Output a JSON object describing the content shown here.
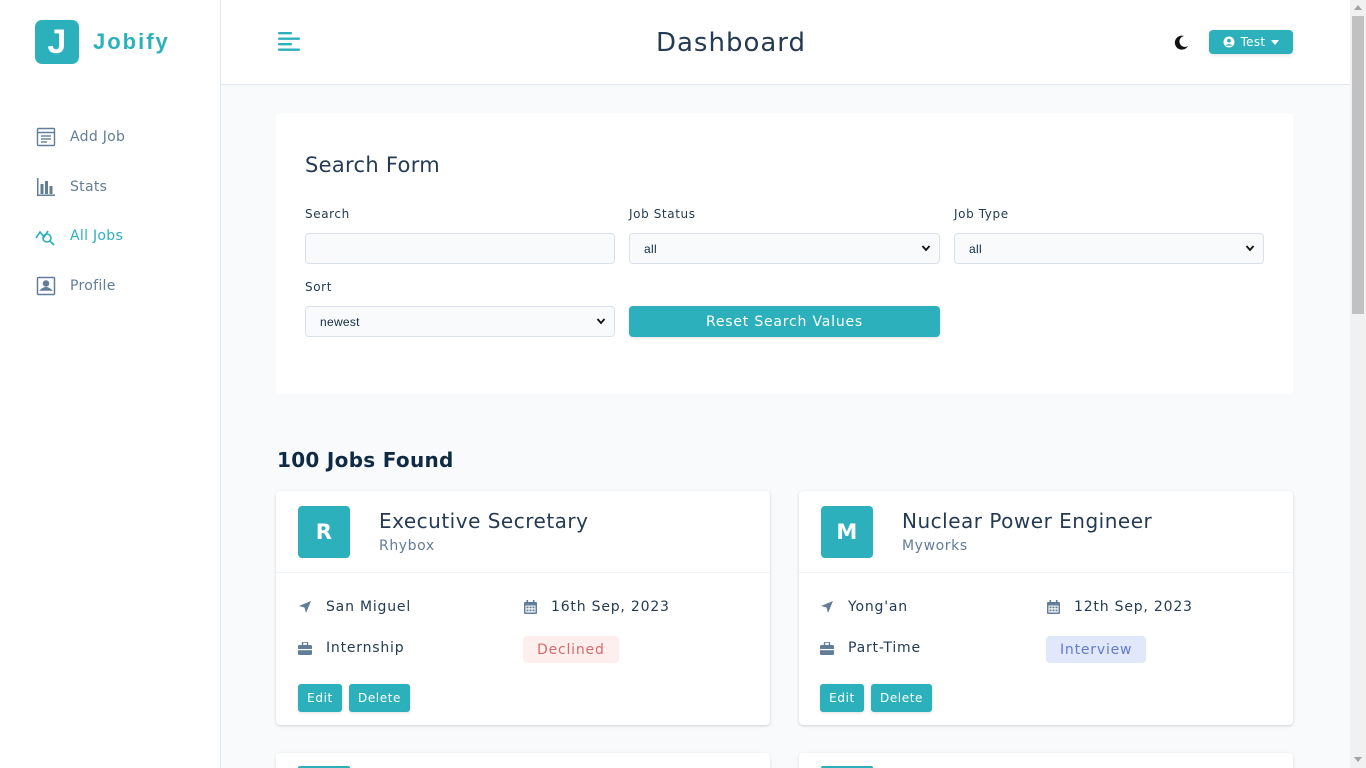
{
  "brand": {
    "logo_letter": "J",
    "name": "Jobify",
    "color": "#2cb1bc"
  },
  "header": {
    "title": "Dashboard",
    "user_label": "Test"
  },
  "sidebar": {
    "items": [
      {
        "label": "Add Job",
        "icon": "add-job-icon",
        "active": false
      },
      {
        "label": "Stats",
        "icon": "stats-icon",
        "active": false
      },
      {
        "label": "All Jobs",
        "icon": "all-jobs-icon",
        "active": true
      },
      {
        "label": "Profile",
        "icon": "profile-icon",
        "active": false
      }
    ]
  },
  "search_form": {
    "title": "Search Form",
    "search_label": "Search",
    "search_value": "",
    "status_label": "Job Status",
    "status_value": "all",
    "type_label": "Job Type",
    "type_value": "all",
    "sort_label": "Sort",
    "sort_value": "newest",
    "reset_label": "Reset Search Values"
  },
  "jobs_count": "100 Jobs Found",
  "jobs": [
    {
      "initial": "R",
      "position": "Executive Secretary",
      "company": "Rhybox",
      "location": "San Miguel",
      "date": "16th Sep, 2023",
      "type": "Internship",
      "status": "Declined",
      "edit_label": "Edit",
      "delete_label": "Delete"
    },
    {
      "initial": "M",
      "position": "Nuclear Power Engineer",
      "company": "Myworks",
      "location": "Yong'an",
      "date": "12th Sep, 2023",
      "type": "Part-Time",
      "status": "Interview",
      "edit_label": "Edit",
      "delete_label": "Delete"
    }
  ],
  "status_colors": {
    "declined_bg": "#ffeeee",
    "declined_text": "#d66a6a",
    "interview_bg": "#e0e8f9",
    "interview_text": "#647acb"
  }
}
